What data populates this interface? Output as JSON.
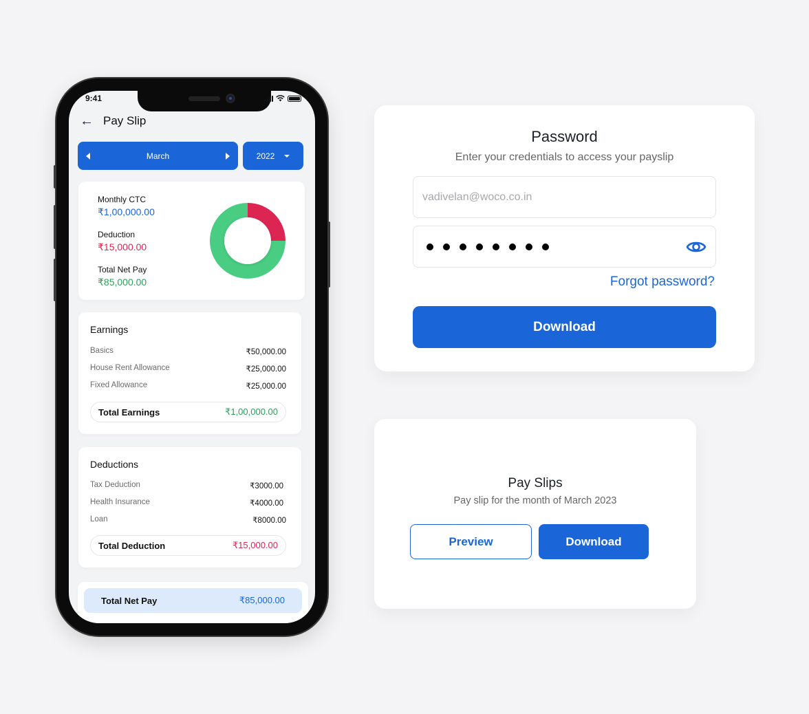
{
  "colors": {
    "brand": "#1a66d9",
    "deduction": "#dc2552",
    "earnings": "#2e9f5c",
    "donut_green": "#48cd82",
    "donut_red": "#dc2552",
    "net_pill_bg": "#dceafc"
  },
  "phone": {
    "status_bar": {
      "time": "9:41"
    },
    "header": {
      "back_icon": "arrow-left-icon",
      "title": "Pay Slip"
    },
    "month_selector": {
      "value": "March",
      "prev_icon": "caret-left-icon",
      "next_icon": "caret-right-icon"
    },
    "year_selector": {
      "value": "2022",
      "icon": "caret-down-icon"
    },
    "summary": {
      "items": [
        {
          "label": "Monthly CTC",
          "value": "₹1,00,000.00"
        },
        {
          "label": "Deduction",
          "value": "₹15,000.00"
        },
        {
          "label": "Total Net Pay",
          "value": "₹85,000.00"
        }
      ],
      "donut": {
        "segments": [
          {
            "name": "Deduction",
            "fraction": 0.25
          },
          {
            "name": "Net Pay",
            "fraction": 0.75
          }
        ]
      }
    },
    "earnings": {
      "title": "Earnings",
      "rows": [
        {
          "label": "Basics",
          "value": "₹50,000.00"
        },
        {
          "label": "House Rent Allowance",
          "value": "₹25,000.00"
        },
        {
          "label": "Fixed Allowance",
          "value": "₹25,000.00"
        }
      ],
      "total_label": "Total Earnings",
      "total_value": "₹1,00,000.00"
    },
    "deductions": {
      "title": "Deductions",
      "rows": [
        {
          "label": "Tax Deduction",
          "value": "₹3000.00"
        },
        {
          "label": "Health Insurance",
          "value": "₹4000.00"
        },
        {
          "label": "Loan",
          "value": "₹8000.00"
        }
      ],
      "total_label": "Total Deduction",
      "total_value": "₹15,000.00"
    },
    "net_pay": {
      "label": "Total Net Pay",
      "value": "₹85,000.00"
    }
  },
  "password_card": {
    "title": "Password",
    "subtitle": "Enter your credentials to access your payslip",
    "email_placeholder": "vadivelan@woco.co.in",
    "password_length": 8,
    "eye_icon": "eye-icon",
    "forgot_label": "Forgot password?",
    "download_label": "Download"
  },
  "payslips_card": {
    "title": "Pay Slips",
    "subtitle": "Pay slip for the month of March 2023",
    "preview_label": "Preview",
    "download_label": "Download"
  }
}
